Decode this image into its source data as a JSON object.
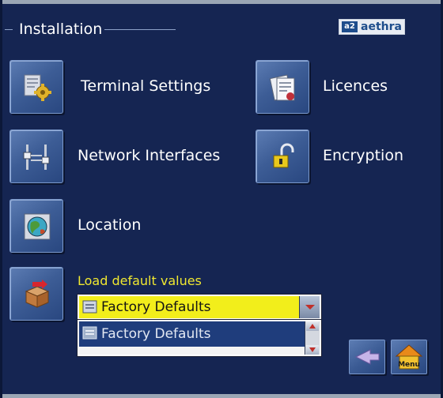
{
  "header": {
    "title": "Installation",
    "logo_mark": "a2",
    "logo_text": "aethra"
  },
  "menu": {
    "terminal_settings": "Terminal Settings",
    "licences": "Licences",
    "network_interfaces": "Network Interfaces",
    "encryption": "Encryption",
    "location": "Location"
  },
  "defaults": {
    "label": "Load default values",
    "selected": "Factory Defaults",
    "options": [
      "Factory Defaults"
    ]
  },
  "nav": {
    "menu_label": "Menu"
  },
  "colors": {
    "background": "#152552",
    "highlight": "#f2ee1b",
    "label_accent": "#f0e830"
  },
  "icons": [
    "settings-gear-icon",
    "certificate-icon",
    "network-adapter-icon",
    "padlock-open-icon",
    "globe-icon",
    "box-arrow-icon",
    "back-arrow-icon",
    "home-icon"
  ]
}
